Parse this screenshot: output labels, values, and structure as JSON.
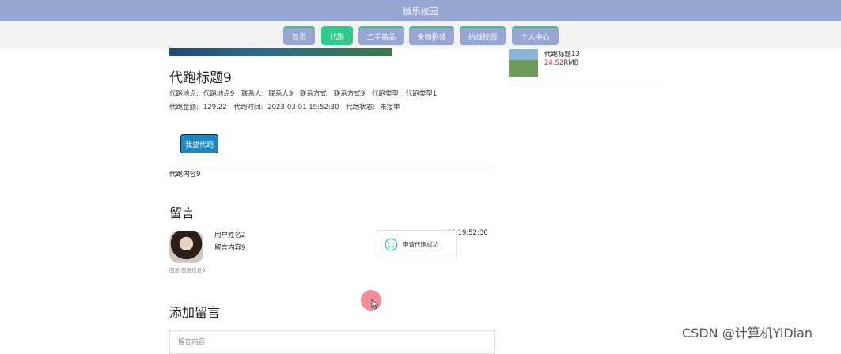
{
  "app": {
    "title": "微乐校园"
  },
  "nav": {
    "items": [
      {
        "label": "首页"
      },
      {
        "label": "代跑"
      },
      {
        "label": "二手商品"
      },
      {
        "label": "失物招领"
      },
      {
        "label": "约战校园"
      },
      {
        "label": "个人中心"
      }
    ],
    "active_index": 1
  },
  "detail": {
    "title": "代跑标题9",
    "location_label": "代跑地点:",
    "location": "代跑地点9",
    "contact_label": "联系人:",
    "contact": "联系人9",
    "contact_method_label": "联系方式:",
    "contact_method": "联系方式9",
    "type_label": "代跑类型:",
    "type": "代跑类型1",
    "amount_label": "代跑金额:",
    "amount": "129.22",
    "time_label": "代跑时间:",
    "time": "2023-03-01 19:52:30",
    "status_label": "代跑状态:",
    "status": "未接单",
    "action_button": "我要代跑",
    "content": "代跑内容9"
  },
  "comments": {
    "heading": "留言",
    "items": [
      {
        "user": "用户姓名2",
        "body": "留言内容9",
        "reply": "回复:回复信息9",
        "time": "-01 19:52:30"
      }
    ]
  },
  "add_comment": {
    "heading": "添加留言",
    "placeholder": "留言内容"
  },
  "toast": {
    "message": "申请代跑成功",
    "icon": "smile-icon"
  },
  "sidebar": {
    "items": [
      {
        "title": "代跑标题13",
        "price": "24.52",
        "unit": "RMB"
      }
    ]
  },
  "watermark": "CSDN @计算机YiDian",
  "colors": {
    "topbar": "#97a6d2",
    "nav_item": "#97a6d2",
    "nav_active": "#2ecc8a",
    "nav_accent": "#34c98b",
    "primary_button": "#1d86c4",
    "price": "#e02020"
  }
}
